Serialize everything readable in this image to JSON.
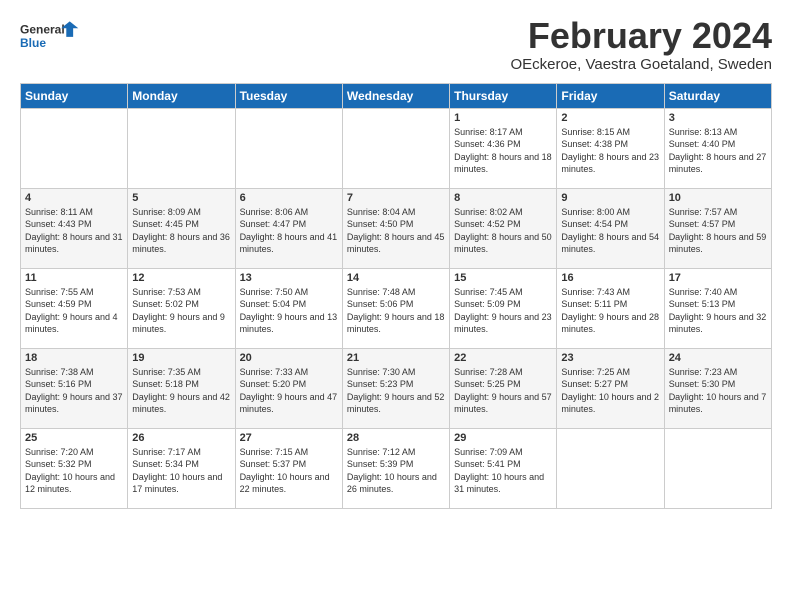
{
  "logo": {
    "general": "General",
    "blue": "Blue"
  },
  "title": "February 2024",
  "location": "OEckeroe, Vaestra Goetaland, Sweden",
  "days_of_week": [
    "Sunday",
    "Monday",
    "Tuesday",
    "Wednesday",
    "Thursday",
    "Friday",
    "Saturday"
  ],
  "weeks": [
    [
      {
        "day": "",
        "sunrise": "",
        "sunset": "",
        "daylight": ""
      },
      {
        "day": "",
        "sunrise": "",
        "sunset": "",
        "daylight": ""
      },
      {
        "day": "",
        "sunrise": "",
        "sunset": "",
        "daylight": ""
      },
      {
        "day": "",
        "sunrise": "",
        "sunset": "",
        "daylight": ""
      },
      {
        "day": "1",
        "sunrise": "Sunrise: 8:17 AM",
        "sunset": "Sunset: 4:36 PM",
        "daylight": "Daylight: 8 hours and 18 minutes."
      },
      {
        "day": "2",
        "sunrise": "Sunrise: 8:15 AM",
        "sunset": "Sunset: 4:38 PM",
        "daylight": "Daylight: 8 hours and 23 minutes."
      },
      {
        "day": "3",
        "sunrise": "Sunrise: 8:13 AM",
        "sunset": "Sunset: 4:40 PM",
        "daylight": "Daylight: 8 hours and 27 minutes."
      }
    ],
    [
      {
        "day": "4",
        "sunrise": "Sunrise: 8:11 AM",
        "sunset": "Sunset: 4:43 PM",
        "daylight": "Daylight: 8 hours and 31 minutes."
      },
      {
        "day": "5",
        "sunrise": "Sunrise: 8:09 AM",
        "sunset": "Sunset: 4:45 PM",
        "daylight": "Daylight: 8 hours and 36 minutes."
      },
      {
        "day": "6",
        "sunrise": "Sunrise: 8:06 AM",
        "sunset": "Sunset: 4:47 PM",
        "daylight": "Daylight: 8 hours and 41 minutes."
      },
      {
        "day": "7",
        "sunrise": "Sunrise: 8:04 AM",
        "sunset": "Sunset: 4:50 PM",
        "daylight": "Daylight: 8 hours and 45 minutes."
      },
      {
        "day": "8",
        "sunrise": "Sunrise: 8:02 AM",
        "sunset": "Sunset: 4:52 PM",
        "daylight": "Daylight: 8 hours and 50 minutes."
      },
      {
        "day": "9",
        "sunrise": "Sunrise: 8:00 AM",
        "sunset": "Sunset: 4:54 PM",
        "daylight": "Daylight: 8 hours and 54 minutes."
      },
      {
        "day": "10",
        "sunrise": "Sunrise: 7:57 AM",
        "sunset": "Sunset: 4:57 PM",
        "daylight": "Daylight: 8 hours and 59 minutes."
      }
    ],
    [
      {
        "day": "11",
        "sunrise": "Sunrise: 7:55 AM",
        "sunset": "Sunset: 4:59 PM",
        "daylight": "Daylight: 9 hours and 4 minutes."
      },
      {
        "day": "12",
        "sunrise": "Sunrise: 7:53 AM",
        "sunset": "Sunset: 5:02 PM",
        "daylight": "Daylight: 9 hours and 9 minutes."
      },
      {
        "day": "13",
        "sunrise": "Sunrise: 7:50 AM",
        "sunset": "Sunset: 5:04 PM",
        "daylight": "Daylight: 9 hours and 13 minutes."
      },
      {
        "day": "14",
        "sunrise": "Sunrise: 7:48 AM",
        "sunset": "Sunset: 5:06 PM",
        "daylight": "Daylight: 9 hours and 18 minutes."
      },
      {
        "day": "15",
        "sunrise": "Sunrise: 7:45 AM",
        "sunset": "Sunset: 5:09 PM",
        "daylight": "Daylight: 9 hours and 23 minutes."
      },
      {
        "day": "16",
        "sunrise": "Sunrise: 7:43 AM",
        "sunset": "Sunset: 5:11 PM",
        "daylight": "Daylight: 9 hours and 28 minutes."
      },
      {
        "day": "17",
        "sunrise": "Sunrise: 7:40 AM",
        "sunset": "Sunset: 5:13 PM",
        "daylight": "Daylight: 9 hours and 32 minutes."
      }
    ],
    [
      {
        "day": "18",
        "sunrise": "Sunrise: 7:38 AM",
        "sunset": "Sunset: 5:16 PM",
        "daylight": "Daylight: 9 hours and 37 minutes."
      },
      {
        "day": "19",
        "sunrise": "Sunrise: 7:35 AM",
        "sunset": "Sunset: 5:18 PM",
        "daylight": "Daylight: 9 hours and 42 minutes."
      },
      {
        "day": "20",
        "sunrise": "Sunrise: 7:33 AM",
        "sunset": "Sunset: 5:20 PM",
        "daylight": "Daylight: 9 hours and 47 minutes."
      },
      {
        "day": "21",
        "sunrise": "Sunrise: 7:30 AM",
        "sunset": "Sunset: 5:23 PM",
        "daylight": "Daylight: 9 hours and 52 minutes."
      },
      {
        "day": "22",
        "sunrise": "Sunrise: 7:28 AM",
        "sunset": "Sunset: 5:25 PM",
        "daylight": "Daylight: 9 hours and 57 minutes."
      },
      {
        "day": "23",
        "sunrise": "Sunrise: 7:25 AM",
        "sunset": "Sunset: 5:27 PM",
        "daylight": "Daylight: 10 hours and 2 minutes."
      },
      {
        "day": "24",
        "sunrise": "Sunrise: 7:23 AM",
        "sunset": "Sunset: 5:30 PM",
        "daylight": "Daylight: 10 hours and 7 minutes."
      }
    ],
    [
      {
        "day": "25",
        "sunrise": "Sunrise: 7:20 AM",
        "sunset": "Sunset: 5:32 PM",
        "daylight": "Daylight: 10 hours and 12 minutes."
      },
      {
        "day": "26",
        "sunrise": "Sunrise: 7:17 AM",
        "sunset": "Sunset: 5:34 PM",
        "daylight": "Daylight: 10 hours and 17 minutes."
      },
      {
        "day": "27",
        "sunrise": "Sunrise: 7:15 AM",
        "sunset": "Sunset: 5:37 PM",
        "daylight": "Daylight: 10 hours and 22 minutes."
      },
      {
        "day": "28",
        "sunrise": "Sunrise: 7:12 AM",
        "sunset": "Sunset: 5:39 PM",
        "daylight": "Daylight: 10 hours and 26 minutes."
      },
      {
        "day": "29",
        "sunrise": "Sunrise: 7:09 AM",
        "sunset": "Sunset: 5:41 PM",
        "daylight": "Daylight: 10 hours and 31 minutes."
      },
      {
        "day": "",
        "sunrise": "",
        "sunset": "",
        "daylight": ""
      },
      {
        "day": "",
        "sunrise": "",
        "sunset": "",
        "daylight": ""
      }
    ]
  ]
}
